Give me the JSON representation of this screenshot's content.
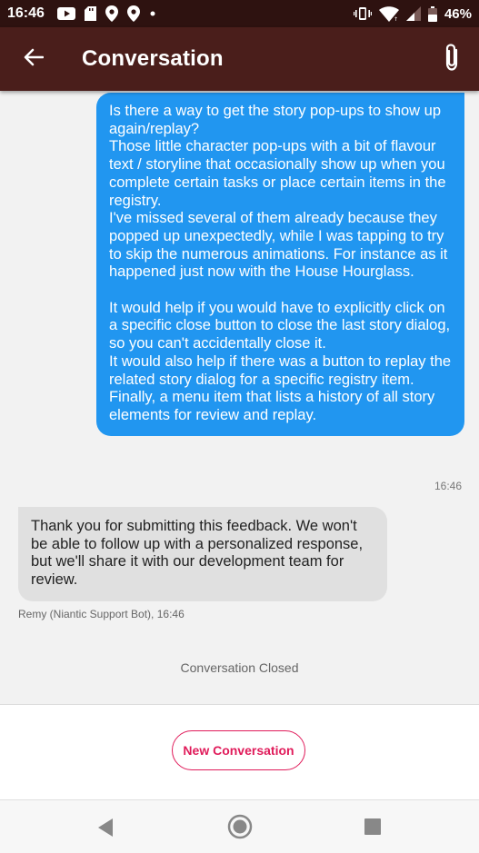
{
  "status_bar": {
    "time": "16:46",
    "battery": "46%",
    "icons_left": [
      "youtube-icon",
      "sd-card-icon",
      "location-pin-icon",
      "location-pin-icon",
      "dot-icon"
    ],
    "icons_right": [
      "vibrate-icon",
      "wifi-icon",
      "signal-icon",
      "battery-icon"
    ]
  },
  "app_bar": {
    "title": "Conversation",
    "back_icon": "arrow-left-icon",
    "attach_icon": "paperclip-icon"
  },
  "messages": [
    {
      "direction": "outgoing",
      "text": "Is there a way to get the story pop-ups to show up again/replay?\nThose little character pop-ups with a bit of flavour text / storyline that occasionally show up when you complete certain tasks or place certain items in the registry.\nI've missed several of them already because they popped up unexpectedly, while I was tapping to try to skip the numerous animations. For instance as it happened just now with the House Hourglass.\n\nIt would help if you would have to explicitly click on a specific close button to close the last story dialog, so you can't accidentally close it.\nIt would also help if there was a button to replay the related story dialog for a specific registry item.\nFinally, a menu item that lists a history of all story elements for review and replay.",
      "time": "16:46"
    },
    {
      "direction": "incoming",
      "text": "Thank you for submitting this feedback. We won't be able to follow up with a personalized response, but we'll share it with our development team for review.",
      "meta": "Remy (Niantic Support Bot), 16:46"
    }
  ],
  "conversation_status": "Conversation Closed",
  "new_conversation_label": "New Conversation",
  "colors": {
    "status_bar": "#2e1210",
    "app_bar": "#4a1e1b",
    "outgoing_bubble": "#2196f0",
    "incoming_bubble": "#e0e0e0",
    "accent": "#e01b5a"
  }
}
